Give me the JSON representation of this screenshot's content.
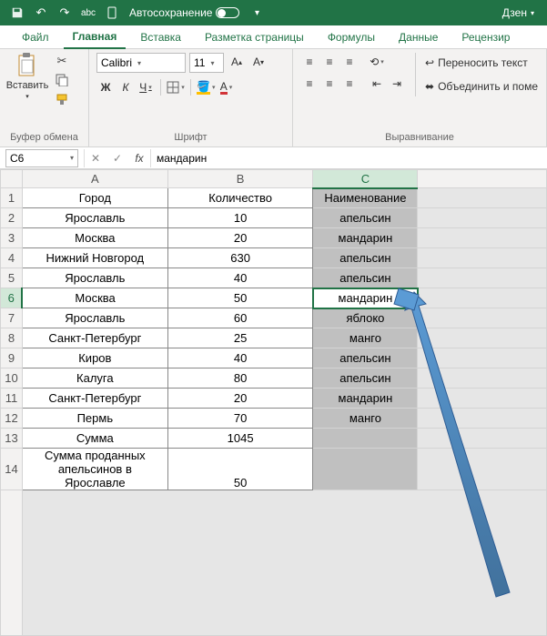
{
  "titlebar": {
    "autosave_label": "Автосохранение",
    "mainmenu": "Дзен"
  },
  "tabs": {
    "file": "Файл",
    "home": "Главная",
    "insert": "Вставка",
    "layout": "Разметка страницы",
    "formulas": "Формулы",
    "data": "Данные",
    "review": "Рецензир"
  },
  "ribbon": {
    "clipboard": {
      "label": "Буфер обмена",
      "paste": "Вставить"
    },
    "font": {
      "label": "Шрифт",
      "name": "Calibri",
      "size": "11",
      "bold": "Ж",
      "italic": "К",
      "underline": "Ч"
    },
    "alignment": {
      "label": "Выравнивание",
      "wrap": "Переносить текст",
      "merge": "Объединить и поме"
    }
  },
  "fbar": {
    "cellref": "C6",
    "fx": "fx",
    "formula": "мандарин"
  },
  "columns": {
    "A": "A",
    "B": "B",
    "C": "C"
  },
  "sheet": {
    "header": {
      "A": "Город",
      "B": "Количество",
      "C": "Наименование"
    },
    "rows": [
      {
        "n": "2",
        "A": "Ярославль",
        "B": "10",
        "C": "апельсин"
      },
      {
        "n": "3",
        "A": "Москва",
        "B": "20",
        "C": "мандарин"
      },
      {
        "n": "4",
        "A": "Нижний Новгород",
        "B": "630",
        "C": "апельсин"
      },
      {
        "n": "5",
        "A": "Ярославль",
        "B": "40",
        "C": "апельсин"
      },
      {
        "n": "6",
        "A": "Москва",
        "B": "50",
        "C": "мандарин"
      },
      {
        "n": "7",
        "A": "Ярославль",
        "B": "60",
        "C": "яблоко"
      },
      {
        "n": "8",
        "A": "Санкт-Петербург",
        "B": "25",
        "C": "манго"
      },
      {
        "n": "9",
        "A": "Киров",
        "B": "40",
        "C": "апельсин"
      },
      {
        "n": "10",
        "A": "Калуга",
        "B": "80",
        "C": "апельсин"
      },
      {
        "n": "11",
        "A": "Санкт-Петербург",
        "B": "20",
        "C": "мандарин"
      },
      {
        "n": "12",
        "A": "Пермь",
        "B": "70",
        "C": "манго"
      }
    ],
    "sumrow": {
      "n": "13",
      "A": "Сумма",
      "B": "1045"
    },
    "extrarow": {
      "n": "14",
      "A": "Сумма проданных апельсинов в Ярославле",
      "B": "50"
    },
    "selected_row": "6"
  }
}
